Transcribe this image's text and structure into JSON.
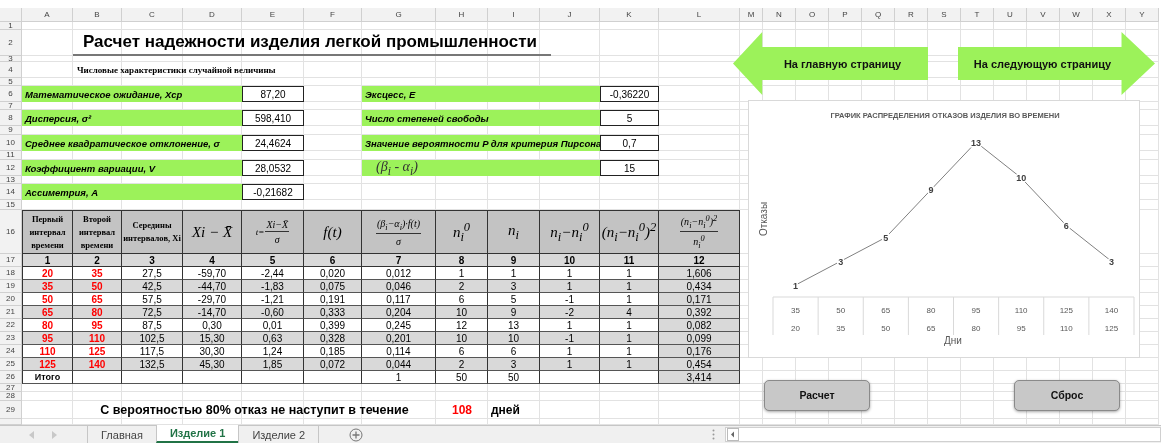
{
  "columns": [
    "A",
    "B",
    "C",
    "D",
    "E",
    "F",
    "G",
    "H",
    "I",
    "J",
    "K",
    "L",
    "M",
    "N",
    "O",
    "P",
    "Q",
    "R",
    "S",
    "T",
    "U",
    "V",
    "W",
    "X",
    "Y"
  ],
  "rows": [
    "1",
    "2",
    "3",
    "4",
    "5",
    "6",
    "7",
    "8",
    "9",
    "10",
    "11",
    "12",
    "13",
    "14",
    "15",
    "16",
    "17",
    "18",
    "19",
    "20",
    "21",
    "22",
    "23",
    "24",
    "25",
    "26",
    "27",
    "28",
    "29"
  ],
  "title": "Расчет надежности изделия легкой промышленности",
  "subtitle": "Числовые характеристики случайной величины",
  "stats_left": [
    {
      "label": "Математическое ожидание, Хср",
      "value": "87,20"
    },
    {
      "label": "Дисперсия,  σ²",
      "value": "598,410"
    },
    {
      "label": "Среднее квадратическое отклонение,  σ",
      "value": "24,4624"
    },
    {
      "label": "Коэффициент вариации, V",
      "value": "28,0532"
    },
    {
      "label": "Ассиметрия, А",
      "value": "-0,21682"
    }
  ],
  "stats_right": [
    {
      "kind": "text",
      "label": "Эксцесс, Е",
      "value": "-0,36220"
    },
    {
      "kind": "text",
      "label": "Число степеней свободы",
      "value": "5"
    },
    {
      "kind": "text",
      "label": "Значение вероятности P для критерия Пирсона",
      "value": "0,7"
    },
    {
      "kind": "math",
      "label": "(β$_{i}$ - α$_{i}$)",
      "value": "15"
    }
  ],
  "table": {
    "columns": [
      {
        "kind": "text",
        "header": "Первый интервал времени",
        "color": "#ff0000"
      },
      {
        "kind": "text",
        "header": "Второй интервал времени",
        "color": "#ff0000"
      },
      {
        "kind": "text",
        "header": "Середины интервалов, Xi"
      },
      {
        "kind": "math",
        "header": "Xi − X̄"
      },
      {
        "kind": "fraction",
        "prefix": "t=",
        "numerator": "Xi−X̄",
        "denominator": "σ"
      },
      {
        "kind": "math",
        "header": "f(t)"
      },
      {
        "kind": "fraction",
        "numerator": "(β$_{i}$−α$_{i}$)·f(t)",
        "denominator": "σ"
      },
      {
        "kind": "math",
        "header": "n$_{i}$$^{0}$"
      },
      {
        "kind": "math",
        "header": "n$_{i}$"
      },
      {
        "kind": "math",
        "header": "n$_{i}$−n$_{i}$$^{0}$"
      },
      {
        "kind": "math",
        "header": "(n$_{i}$−n$_{i}$$^{0}$)$^{2}$"
      },
      {
        "kind": "fraction",
        "numerator": "(n$_{i}$−n$_{i}$$^{0}$)$^{2}$",
        "denominator": "n$_{i}$$^{0}$"
      }
    ],
    "index_row": [
      "1",
      "2",
      "3",
      "4",
      "5",
      "6",
      "7",
      "8",
      "9",
      "10",
      "11",
      "12"
    ],
    "rows": [
      [
        "20",
        "35",
        "27,5",
        "-59,70",
        "-2,44",
        "0,020",
        "0,012",
        "1",
        "1",
        "1",
        "1",
        "1,606"
      ],
      [
        "35",
        "50",
        "42,5",
        "-44,70",
        "-1,83",
        "0,075",
        "0,046",
        "2",
        "3",
        "1",
        "1",
        "0,434"
      ],
      [
        "50",
        "65",
        "57,5",
        "-29,70",
        "-1,21",
        "0,191",
        "0,117",
        "6",
        "5",
        "-1",
        "1",
        "0,171"
      ],
      [
        "65",
        "80",
        "72,5",
        "-14,70",
        "-0,60",
        "0,333",
        "0,204",
        "10",
        "9",
        "-2",
        "4",
        "0,392"
      ],
      [
        "80",
        "95",
        "87,5",
        "0,30",
        "0,01",
        "0,399",
        "0,245",
        "12",
        "13",
        "1",
        "1",
        "0,082"
      ],
      [
        "95",
        "110",
        "102,5",
        "15,30",
        "0,63",
        "0,328",
        "0,201",
        "10",
        "10",
        "-1",
        "1",
        "0,099"
      ],
      [
        "110",
        "125",
        "117,5",
        "30,30",
        "1,24",
        "0,185",
        "0,114",
        "6",
        "6",
        "1",
        "1",
        "0,176"
      ],
      [
        "125",
        "140",
        "132,5",
        "45,30",
        "1,85",
        "0,072",
        "0,044",
        "2",
        "3",
        "1",
        "1",
        "0,454"
      ]
    ],
    "total_row": {
      "label": "Итого",
      "values": {
        "7": "1",
        "8": "50",
        "9": "50",
        "12": "3,414"
      }
    }
  },
  "result": {
    "text": "С вероятностью 80% отказ не наступит в течение",
    "value": "108",
    "unit": "дней"
  },
  "navigation": {
    "back": "На главную страницу",
    "next": "На следующую страницу"
  },
  "chart": {
    "chart_data": {
      "type": "line",
      "title": "ГРАФИК РАСПРЕДЕЛЕНИЯ ОТКАЗОВ ИЗДЕЛИЯ ВО ВРЕМЕНИ",
      "xlabel": "Дни",
      "ylabel": "Отказы",
      "categories": [
        [
          "35",
          "20"
        ],
        [
          "50",
          "35"
        ],
        [
          "65",
          "50"
        ],
        [
          "80",
          "65"
        ],
        [
          "95",
          "80"
        ],
        [
          "110",
          "95"
        ],
        [
          "125",
          "110"
        ],
        [
          "140",
          "125"
        ]
      ],
      "series": [
        {
          "color": "#808080",
          "values": [
            1,
            3,
            5,
            9,
            13,
            10,
            6,
            3
          ]
        }
      ],
      "data_labels": true
    }
  },
  "buttons": {
    "calculate": "Расчет",
    "reset": "Сброс"
  },
  "sheet_tabs": [
    {
      "label": "Главная",
      "selected": false
    },
    {
      "label": "Изделие 1",
      "selected": true
    },
    {
      "label": "Изделие 2",
      "selected": false
    }
  ]
}
